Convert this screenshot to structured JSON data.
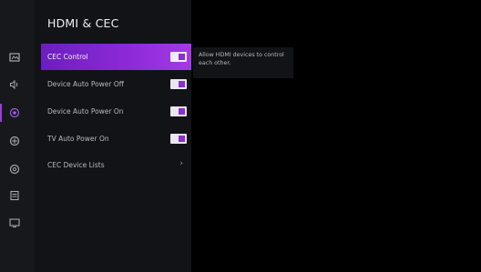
{
  "header": {
    "title": "HDMI & CEC"
  },
  "sidebar": {
    "icons": [
      {
        "name": "picture-icon"
      },
      {
        "name": "sound-icon"
      },
      {
        "name": "connection-icon"
      },
      {
        "name": "accessibility-icon"
      },
      {
        "name": "settings-icon"
      },
      {
        "name": "system-icon"
      },
      {
        "name": "display-icon"
      }
    ]
  },
  "menu": {
    "items": [
      {
        "label": "CEC Control",
        "type": "toggle",
        "on": true
      },
      {
        "label": "Device Auto Power Off",
        "type": "toggle",
        "on": true
      },
      {
        "label": "Device Auto Power On",
        "type": "toggle",
        "on": true
      },
      {
        "label": "TV Auto Power On",
        "type": "toggle",
        "on": true
      },
      {
        "label": "CEC Device Lists",
        "type": "submenu",
        "chevron": "›"
      }
    ]
  },
  "tooltip": {
    "text": "Allow HDMI devices to control each other."
  },
  "colors": {
    "accent": "#8e2ad8",
    "panel": "#121317",
    "rail": "#17181c"
  }
}
